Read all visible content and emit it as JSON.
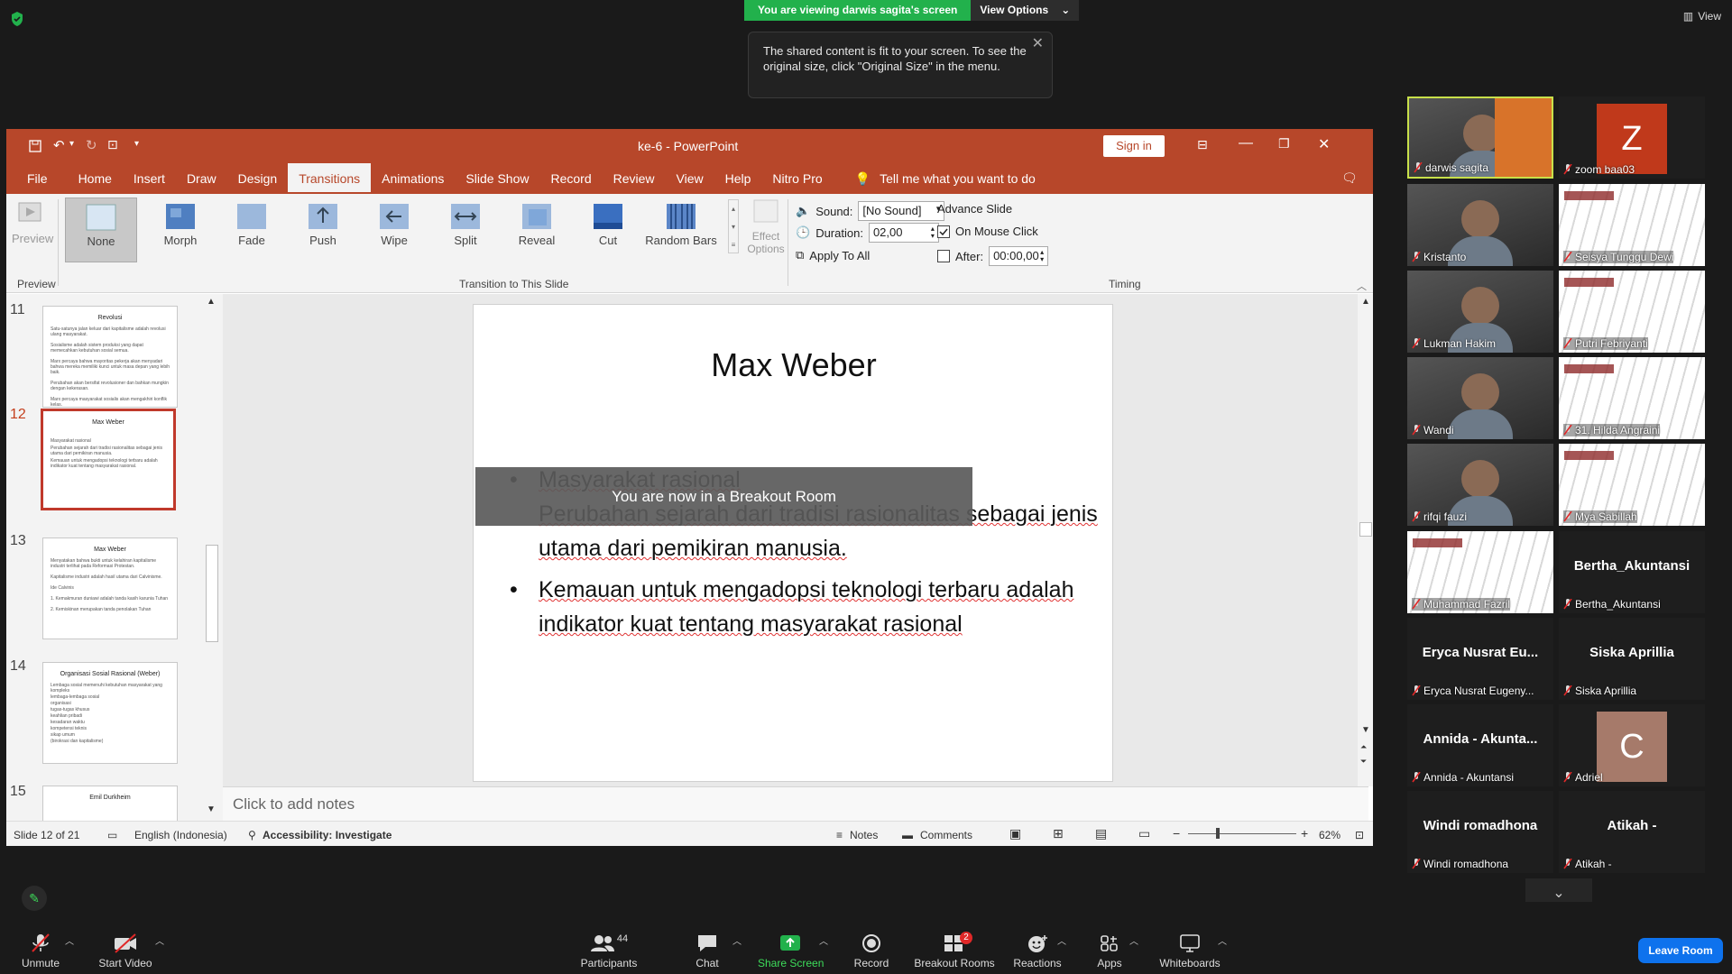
{
  "zoom_banner": {
    "viewing": "You are viewing darwis sagita's screen",
    "view_options": "View Options",
    "view_btn": "View"
  },
  "tooltip": {
    "text": "The shared content is fit to your screen. To see the original size, click \"Original Size\" in the menu."
  },
  "ppt": {
    "title": "ke-6  -  PowerPoint",
    "sign_in": "Sign in",
    "tabs": [
      "File",
      "Home",
      "Insert",
      "Draw",
      "Design",
      "Transitions",
      "Animations",
      "Slide Show",
      "Record",
      "Review",
      "View",
      "Help",
      "Nitro Pro"
    ],
    "active_tab": "Transitions",
    "tell_me": "Tell me what you want to do",
    "ribbon": {
      "preview": "Preview",
      "transitions": [
        "None",
        "Morph",
        "Fade",
        "Push",
        "Wipe",
        "Split",
        "Reveal",
        "Cut",
        "Random Bars"
      ],
      "effect_options": "Effect Options",
      "sound_label": "Sound:",
      "sound_value": "[No Sound]",
      "duration_label": "Duration:",
      "duration_value": "02,00",
      "apply_all": "Apply To All",
      "advance_slide": "Advance Slide",
      "on_mouse_click": "On Mouse Click",
      "after_label": "After:",
      "after_value": "00:00,00",
      "groups": {
        "preview": "Preview",
        "transition": "Transition to This Slide",
        "timing": "Timing"
      }
    },
    "thumbnails": [
      {
        "num": "11",
        "title": "Revolusi",
        "lines": [
          "Satu-satunya jalan keluar dari kapitalisme adalah revolusi ulang masyarakat.",
          "Sosialisme adalah sistem produksi yang dapat memecahkan kebutuhan sosial semua.",
          "Marx percaya bahwa mayoritas pekerja akan menyadari bahwa mereka memiliki kunci untuk masa depan yang lebih baik.",
          "Perubahan akan bersifat revolusioner dan bahkan mungkin dengan kekerasan.",
          "Marx percaya masyarakat sosialis akan mengakhiri konflik kelas."
        ]
      },
      {
        "num": "12",
        "title": "Max Weber",
        "lines": [
          "Masyarakat rasional",
          "Perubahan sejarah dari tradisi rasionalitas sebagai jenis utama dari pemikiran manusia.",
          "Kemauan untuk mengadopsi teknologi terbaru adalah indikator kuat tentang masyarakat rasional."
        ]
      },
      {
        "num": "13",
        "title": "Max Weber",
        "lines": [
          "Menyatakan bahwa bukti untuk kelahiran kapitalisme industri terlihat pada Reformasi Protestan.",
          "Kapitalisme industri adalah hasil utama dari Calvinisme.",
          "Ide Calvinis",
          "1. Kemakmuran duniawi adalah tanda kasih karunia Tuhan",
          "2. Kemiskinan merupakan tanda penolakan Tuhan"
        ]
      },
      {
        "num": "14",
        "title": "Organisasi Sosial Rasional (Weber)",
        "lines": [
          "Lembaga sosial memenuhi kebutuhan masyarakat yang kompleks",
          "lembaga-lembaga sosial",
          "organisasi",
          "tugas-tugas khusus",
          "keahlian pribadi",
          "kesadaran waktu",
          "kompetensi teknis",
          "sikap umum",
          "(birokrasi dan kapitalisme)"
        ]
      },
      {
        "num": "15",
        "title": "Emil Durkheim",
        "lines": []
      }
    ],
    "slide": {
      "title": "Max Weber",
      "bullet1_line1": "Masyarakat rasional",
      "bullet1_rest": "Perubahan sejarah dari tradisi rasionalitas sebagai jenis utama dari pemikiran manusia.",
      "bullet2": "Kemauan untuk mengadopsi teknologi terbaru adalah indikator kuat tentang masyarakat rasional"
    },
    "breakout_overlay": "You are now in a Breakout Room",
    "notes_placeholder": "Click to add notes",
    "status": {
      "slide": "Slide 12 of 21",
      "language": "English (Indonesia)",
      "accessibility": "Accessibility: Investigate",
      "notes": "Notes",
      "comments": "Comments",
      "zoom": "62%"
    }
  },
  "participants": [
    {
      "name": "darwis sagita",
      "type": "video"
    },
    {
      "name": "zoom baa03",
      "type": "avatar",
      "letter": "Z",
      "color": "#c0391b"
    },
    {
      "name": "Kristanto",
      "type": "video"
    },
    {
      "name": "Seisya Tunggu Dewi",
      "type": "slide"
    },
    {
      "name": "Lukman Hakim",
      "type": "video"
    },
    {
      "name": "Putri Febriyanti",
      "type": "slide"
    },
    {
      "name": "Wandi",
      "type": "video"
    },
    {
      "name": "31. Hilda Angraini",
      "type": "slide"
    },
    {
      "name": "rifqi fauzi",
      "type": "video"
    },
    {
      "name": "Mya Sabillah",
      "type": "slide"
    },
    {
      "name": "Muhammad Fazril",
      "type": "slide"
    },
    {
      "name": "Bertha_Akuntansi",
      "type": "name",
      "display": "Bertha_Akuntansi"
    },
    {
      "name": "Eryca Nusrat Eugeny...",
      "type": "name",
      "display": "Eryca Nusrat Eu..."
    },
    {
      "name": "Siska Aprillia",
      "type": "name",
      "display": "Siska Aprillia"
    },
    {
      "name": "Annida - Akuntansi",
      "type": "name",
      "display": "Annida - Akunta..."
    },
    {
      "name": "Adriel",
      "type": "avatar",
      "letter": "C",
      "color": "#a67a6a"
    },
    {
      "name": "Windi romadhona",
      "type": "name",
      "display": "Windi romadhona"
    },
    {
      "name": "Atikah -",
      "type": "name",
      "display": "Atikah -"
    }
  ],
  "toolbar": {
    "unmute": "Unmute",
    "start_video": "Start Video",
    "participants": "Participants",
    "participants_count": "44",
    "chat": "Chat",
    "share_screen": "Share Screen",
    "record": "Record",
    "breakout_rooms": "Breakout Rooms",
    "breakout_badge": "2",
    "reactions": "Reactions",
    "apps": "Apps",
    "whiteboards": "Whiteboards",
    "leave": "Leave Room"
  },
  "colors": {
    "ppt_accent": "#b7472a",
    "zoom_green": "#22b14c",
    "leave_blue": "#0e72ed"
  }
}
